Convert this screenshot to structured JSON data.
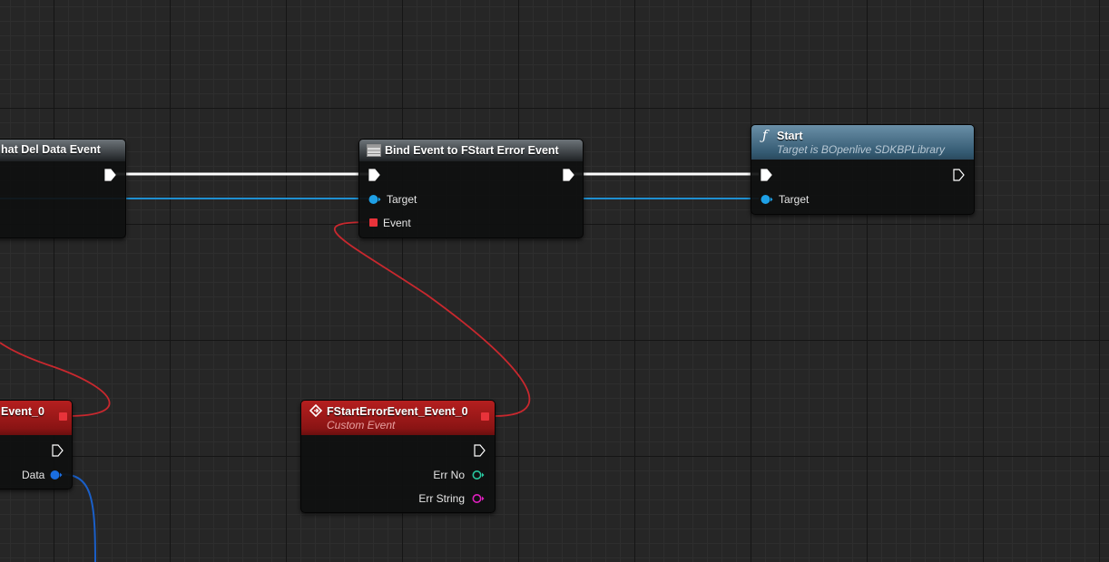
{
  "nodes": {
    "chat_bind": {
      "title": "hat Del Data Event"
    },
    "bind_event": {
      "title": "Bind Event to FStart Error Event",
      "target_label": "Target",
      "event_label": "Event"
    },
    "start_fn": {
      "title": "Start",
      "subtitle": "Target is BOpenlive SDKBPLibrary",
      "target_label": "Target"
    },
    "chat_event": {
      "title": "Event_0",
      "data_label": "Data"
    },
    "start_error_event": {
      "title": "FStartErrorEvent_Event_0",
      "subtitle": "Custom Event",
      "err_no_label": "Err No",
      "err_string_label": "Err String"
    }
  },
  "colors": {
    "exec": "#ffffff",
    "object_pin": "#1ea0e6",
    "delegate_pin": "#e8333a",
    "struct_pin": "#1a6ee0",
    "int_pin": "#28c8a0",
    "string_pin": "#e020c0",
    "function_header": "#345a72",
    "event_header": "#8a1414"
  },
  "icons": {
    "bind_event": "node-table-icon",
    "start_fn": "function-f-icon",
    "custom_event": "event-diamond-icon"
  }
}
